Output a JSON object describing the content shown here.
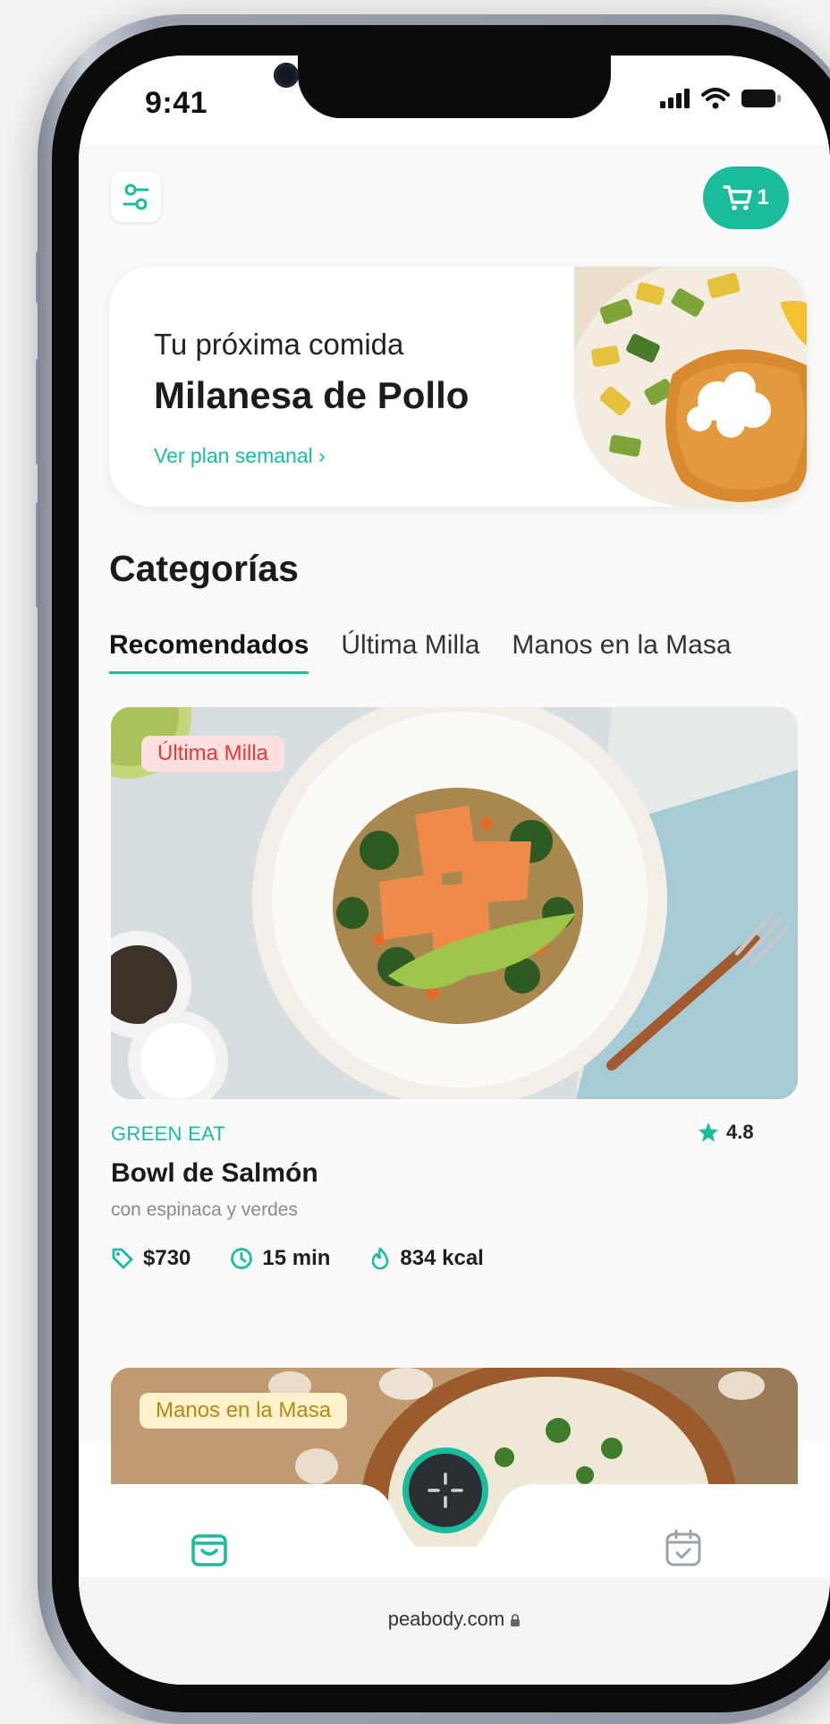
{
  "status_bar": {
    "time": "9:41"
  },
  "header": {
    "cart_count": "1"
  },
  "next_meal": {
    "label": "Tu próxima comida",
    "title": "Milanesa de Pollo",
    "link": "Ver plan semanal ›"
  },
  "categories": {
    "title": "Categorías",
    "tabs": [
      {
        "label": "Recomendados",
        "active": true
      },
      {
        "label": "Última Milla",
        "active": false
      },
      {
        "label": "Manos en la Masa",
        "active": false
      }
    ]
  },
  "meals": [
    {
      "tag": "Última Milla",
      "brand": "GREEN EAT",
      "rating": "4.8",
      "name": "Bowl de Salmón",
      "description": "con espinaca y verdes",
      "price": "$730",
      "time": "15 min",
      "calories": "834 kcal"
    },
    {
      "tag": "Manos en la Masa"
    }
  ],
  "browser": {
    "url": "peabody.com"
  },
  "colors": {
    "accent": "#1bbc9d",
    "tag_red": "#e23a3a",
    "tag_yellow": "#b7890e"
  },
  "icons": [
    "filter-icon",
    "cart-icon",
    "star-icon",
    "price-tag-icon",
    "clock-icon",
    "flame-icon",
    "bag-icon",
    "scan-icon",
    "calendar-check-icon",
    "lock-icon"
  ]
}
